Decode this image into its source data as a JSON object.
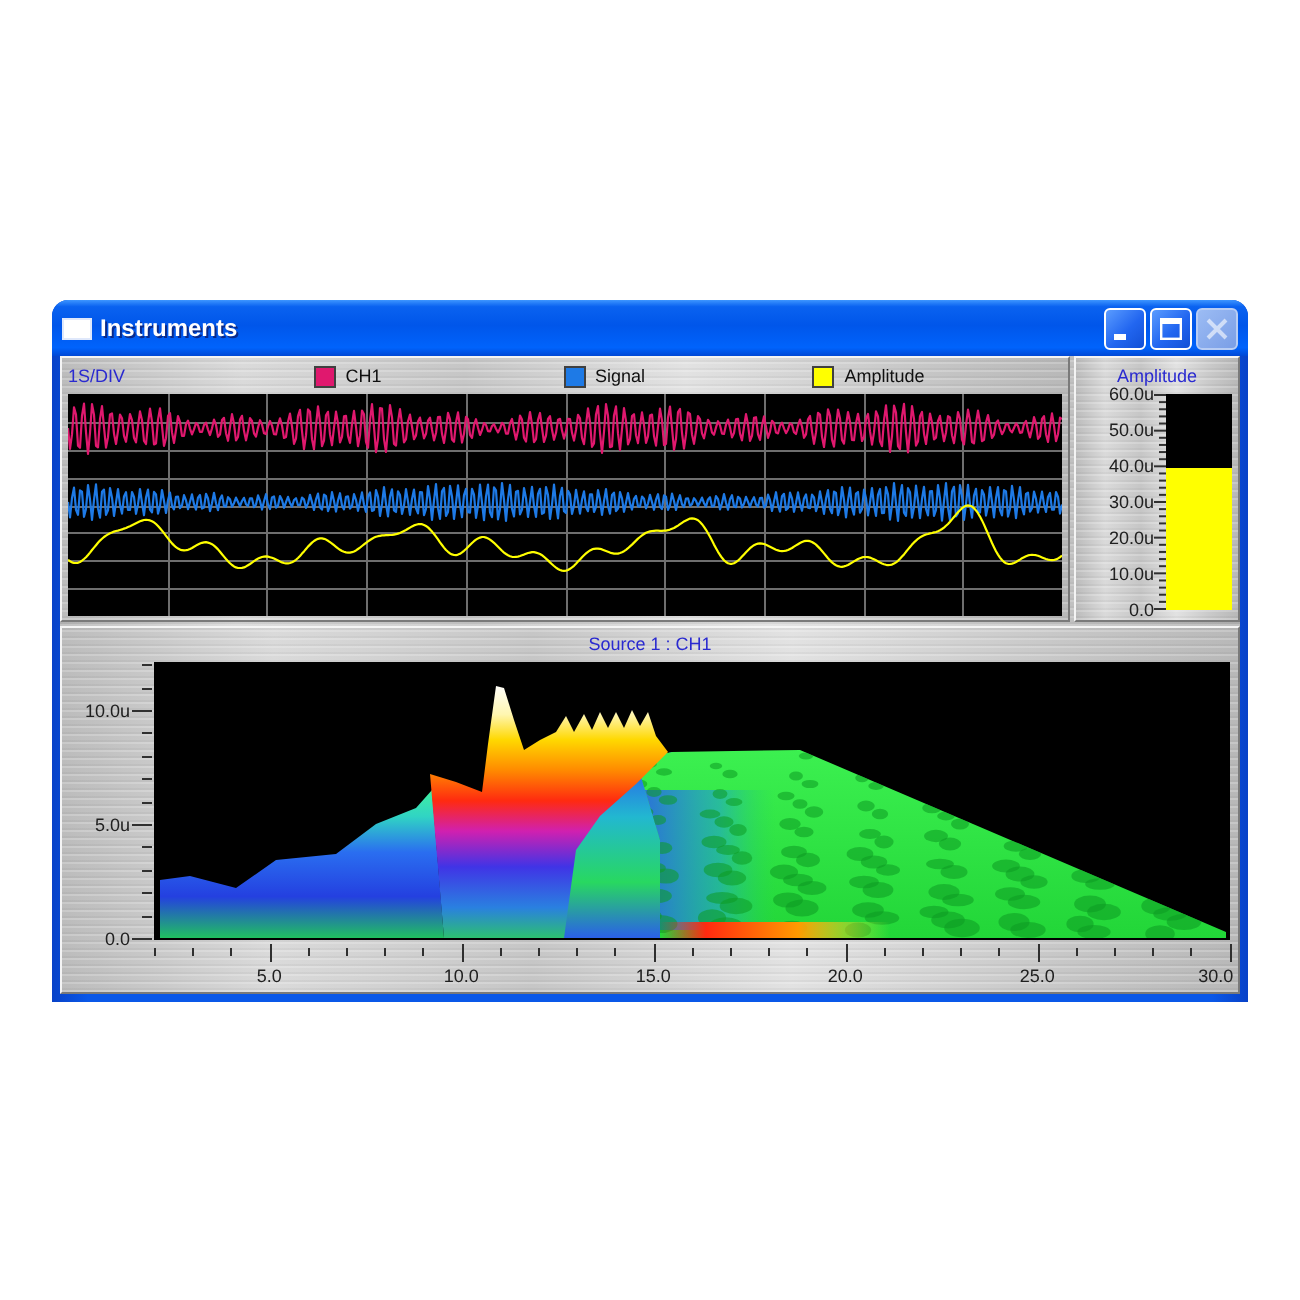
{
  "window": {
    "title": "Instruments",
    "buttons": [
      {
        "kind": "minimize",
        "disabled": false
      },
      {
        "kind": "maximize",
        "disabled": false
      },
      {
        "kind": "close",
        "disabled": true
      }
    ]
  },
  "scope": {
    "scale": "1S/DIV",
    "legend": [
      {
        "label": "CH1",
        "color": "#e0186e"
      },
      {
        "label": "Signal",
        "color": "#1e7ae6"
      },
      {
        "label": "Amplitude",
        "color": "#ffff00"
      }
    ]
  },
  "meter": {
    "title": "Amplitude",
    "labels": [
      "60.0u",
      "50.0u",
      "40.0u",
      "30.0u",
      "20.0u",
      "10.0u",
      "0.0"
    ],
    "level": 0.66
  },
  "surface": {
    "title": "Source 1 : CH1",
    "y_labels": [
      "10.0u",
      "5.0u",
      "0.0"
    ],
    "x_labels": [
      "5.0",
      "10.0",
      "15.0",
      "20.0",
      "25.0",
      "30.0"
    ]
  }
}
